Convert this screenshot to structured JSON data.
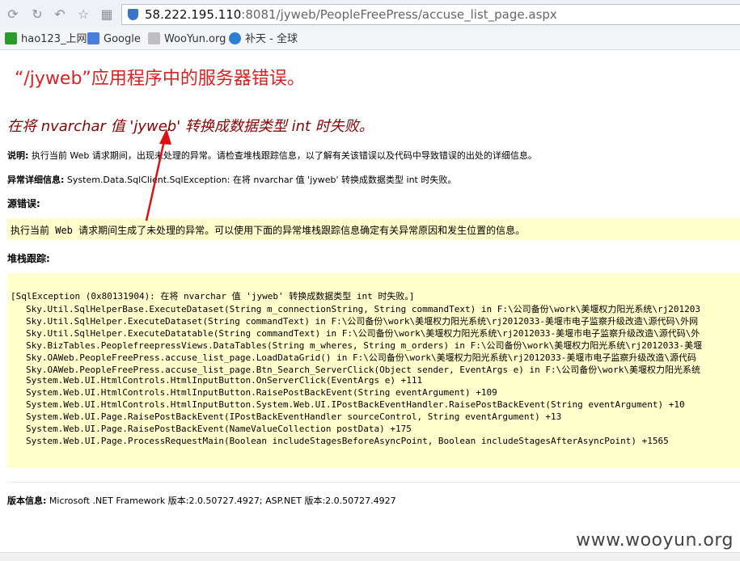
{
  "browser": {
    "url_host": "58.222.195.110",
    "url_rest": ":8081/jyweb/PeopleFreePress/accuse_list_page.aspx",
    "bookmarks": [
      "hao123_上网",
      "Google",
      "WooYun.org",
      "补天 - 全球"
    ]
  },
  "page": {
    "title": "“/jyweb”应用程序中的服务器错误。",
    "error_heading": "在将 nvarchar 值 'jyweb' 转换成数据类型 int 时失败。",
    "desc_label": "说明:",
    "desc_text": " 执行当前 Web 请求期间，出现未处理的异常。请检查堆栈跟踪信息，以了解有关该错误以及代码中导致错误的出处的详细信息。",
    "exception_label": "异常详细信息:",
    "exception_text": " System.Data.SqlClient.SqlException: 在将 nvarchar 值 'jyweb' 转换成数据类型 int 时失败。",
    "source_label": "源错误:",
    "source_text": "执行当前 Web 请求期间生成了未处理的异常。可以使用下面的异常堆栈跟踪信息确定有关异常原因和发生位置的信息。",
    "stack_label": "堆栈跟踪:",
    "stack_lines": [
      "[SqlException (0x80131904): 在将 nvarchar 值 'jyweb' 转换成数据类型 int 时失败。]",
      "Sky.Util.SqlHelperBase.ExecuteDataset(String m_connectionString, String commandText) in F:\\公司备份\\work\\美堰权力阳光系统\\rj201203",
      "Sky.Util.SqlHelper.ExecuteDataset(String commandText) in F:\\公司备份\\work\\美堰权力阳光系统\\rj2012033-美堰市电子监察升级改造\\源代码\\外网",
      "Sky.Util.SqlHelper.ExecuteDatatable(String commandText) in F:\\公司备份\\work\\美堰权力阳光系统\\rj2012033-美堰市电子监察升级改造\\源代码\\外",
      "Sky.BizTables.PeoplefreepressViews.DataTables(String m_wheres, String m_orders) in F:\\公司备份\\work\\美堰权力阳光系统\\rj2012033-美堰",
      "Sky.OAWeb.PeopleFreePress.accuse_list_page.LoadDataGrid() in F:\\公司备份\\work\\美堰权力阳光系统\\rj2012033-美堰市电子监察升级改造\\源代码",
      "Sky.OAWeb.PeopleFreePress.accuse_list_page.Btn_Search_ServerClick(Object sender, EventArgs e) in F:\\公司备份\\work\\美堰权力阳光系统",
      "System.Web.UI.HtmlControls.HtmlInputButton.OnServerClick(EventArgs e) +111",
      "System.Web.UI.HtmlControls.HtmlInputButton.RaisePostBackEvent(String eventArgument) +109",
      "System.Web.UI.HtmlControls.HtmlInputButton.System.Web.UI.IPostBackEventHandler.RaisePostBackEvent(String eventArgument) +10",
      "System.Web.UI.Page.RaisePostBackEvent(IPostBackEventHandler sourceControl, String eventArgument) +13",
      "System.Web.UI.Page.RaisePostBackEvent(NameValueCollection postData) +175",
      "System.Web.UI.Page.ProcessRequestMain(Boolean includeStagesBeforeAsyncPoint, Boolean includeStagesAfterAsyncPoint) +1565"
    ],
    "version_label": "版本信息:",
    "version_text": " Microsoft .NET Framework 版本:2.0.50727.4927; ASP.NET 版本:2.0.50727.4927",
    "watermark": "www.wooyun.org"
  },
  "colors": {
    "title_red": "#e02020",
    "heading_darkred": "#8b0000",
    "highlight_yellow": "#ffffcc",
    "arrow_red": "#e01010"
  }
}
